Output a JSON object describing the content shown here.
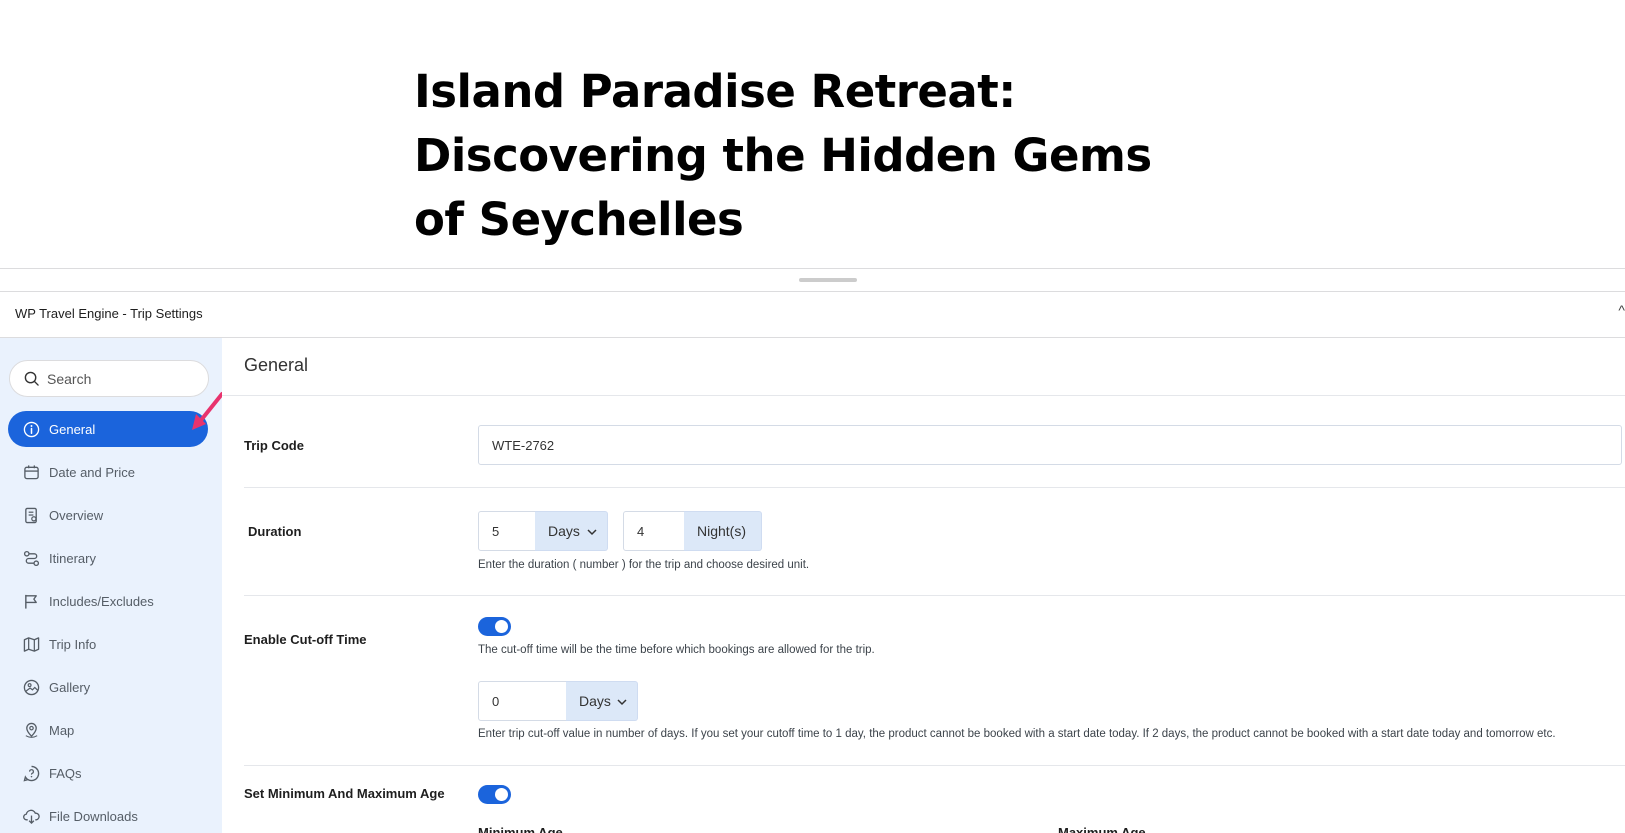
{
  "post": {
    "title": "Island Paradise Retreat: Discovering the Hidden Gems of Seychelles"
  },
  "panel": {
    "title": "WP Travel Engine - Trip Settings",
    "collapse_icon": "chevron-up-icon"
  },
  "sidebar": {
    "search_placeholder": "Search",
    "items": [
      {
        "label": "General",
        "icon": "info-icon",
        "active": true
      },
      {
        "label": "Date and Price",
        "icon": "calendar-icon",
        "active": false
      },
      {
        "label": "Overview",
        "icon": "document-icon",
        "active": false
      },
      {
        "label": "Itinerary",
        "icon": "route-icon",
        "active": false
      },
      {
        "label": "Includes/Excludes",
        "icon": "flag-icon",
        "active": false
      },
      {
        "label": "Trip Info",
        "icon": "map-icon",
        "active": false
      },
      {
        "label": "Gallery",
        "icon": "image-icon",
        "active": false
      },
      {
        "label": "Map",
        "icon": "location-pin-icon",
        "active": false
      },
      {
        "label": "FAQs",
        "icon": "question-icon",
        "active": false
      },
      {
        "label": "File Downloads",
        "icon": "download-icon",
        "active": false
      }
    ]
  },
  "colors": {
    "accent": "#1b64dc",
    "sidebar_bg": "#eaf2fd",
    "annotation_arrow": "#e8336d"
  },
  "main": {
    "title": "General",
    "trip_code": {
      "label": "Trip Code",
      "value": "WTE-2762"
    },
    "duration": {
      "label": "Duration",
      "days_value": "5",
      "days_unit": "Days",
      "nights_value": "4",
      "nights_unit": "Night(s)",
      "help": "Enter the duration ( number ) for the trip and choose desired unit."
    },
    "cutoff": {
      "label": "Enable Cut-off Time",
      "enabled": true,
      "help": "The cut-off time will be the time before which bookings are allowed for the trip.",
      "value": "0",
      "unit": "Days",
      "value_help": "Enter trip cut-off value in number of days. If you set your cutoff time to 1 day, the product cannot be booked with a start date today. If 2 days, the product cannot be booked with a start date today and tomorrow etc."
    },
    "age": {
      "label": "Set Minimum And Maximum Age",
      "enabled": true,
      "min_label": "Minimum Age",
      "max_label": "Maximum Age"
    }
  }
}
